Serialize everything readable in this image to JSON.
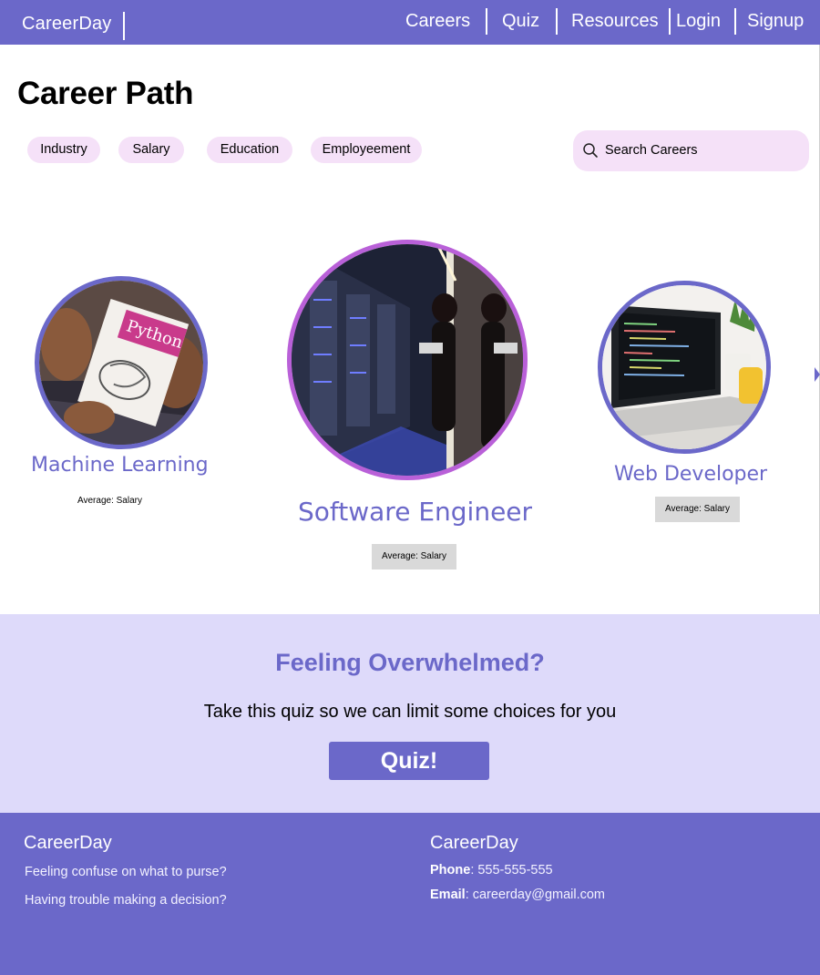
{
  "nav": {
    "brand": "CareerDay",
    "links": [
      "Careers",
      "Quiz",
      "Resources",
      "Login",
      "Signup"
    ]
  },
  "page": {
    "title": "Career Path",
    "filters": [
      "Industry",
      "Salary",
      "Education",
      "Employeement"
    ],
    "search_placeholder": "Search Careers"
  },
  "careers": [
    {
      "title": "Machine Learning",
      "salary_label": "Average: Salary",
      "image": "python-book-photo"
    },
    {
      "title": "Software Engineer",
      "salary_label": "Average: Salary",
      "image": "server-room-photo"
    },
    {
      "title": "Web Developer",
      "salary_label": "Average: Salary",
      "image": "laptop-code-photo"
    }
  ],
  "quiz": {
    "heading": "Feeling Overwhelmed?",
    "subtitle": "Take this quiz so we can limit some choices for you",
    "button": "Quiz!"
  },
  "footer": {
    "left": {
      "brand": "CareerDay",
      "lines": [
        "Feeling confuse on what to purse?",
        "Having trouble making a decision?"
      ]
    },
    "right": {
      "brand": "CareerDay",
      "phone_label": "Phone",
      "phone": ": 555-555-555",
      "email_label": "Email",
      "email": ": careerday@gmail.com"
    }
  },
  "colors": {
    "brand": "#6b68c9",
    "chip": "#f5e1f8",
    "quiz_band": "#dedafa",
    "featured_ring": "#b960d8"
  }
}
